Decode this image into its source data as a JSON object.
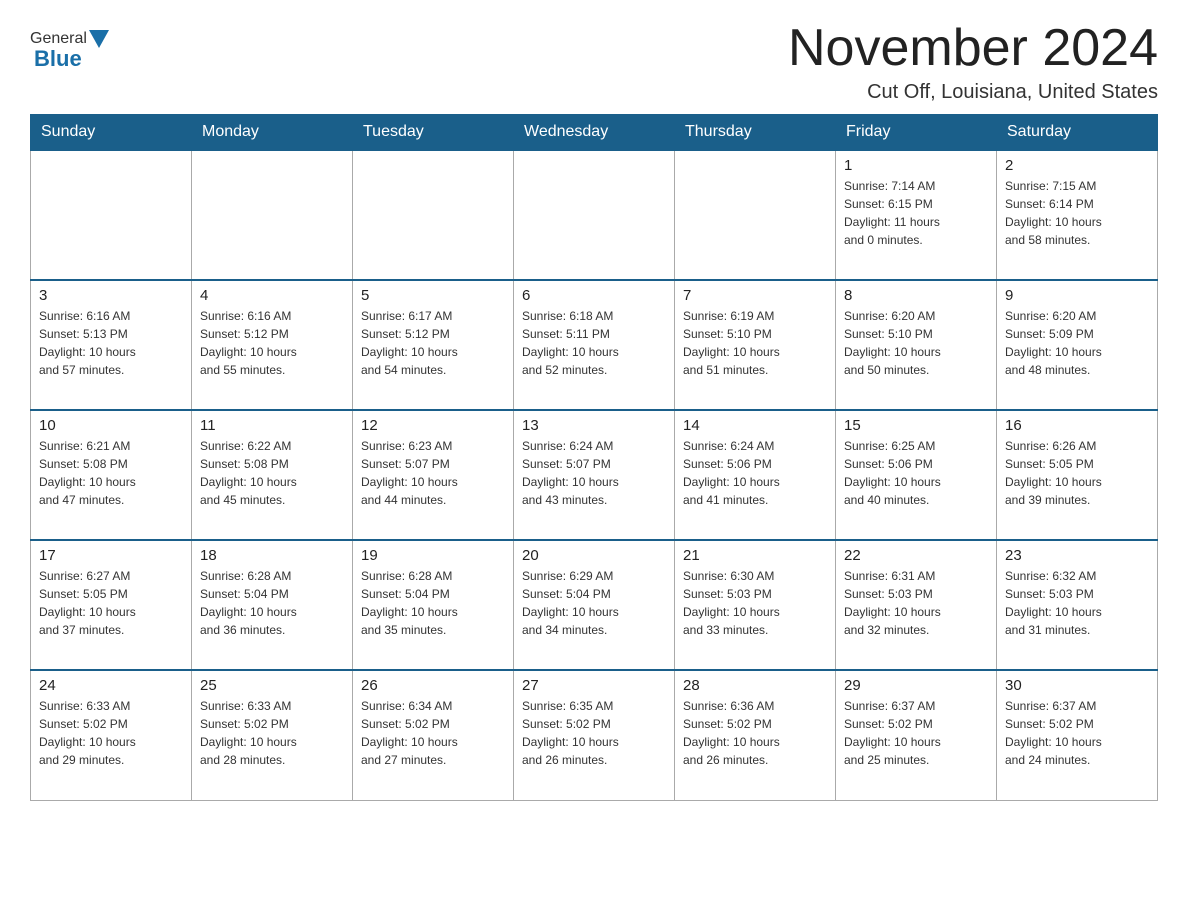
{
  "header": {
    "logo": {
      "general": "General",
      "blue": "Blue"
    },
    "title": "November 2024",
    "subtitle": "Cut Off, Louisiana, United States"
  },
  "calendar": {
    "days_of_week": [
      "Sunday",
      "Monday",
      "Tuesday",
      "Wednesday",
      "Thursday",
      "Friday",
      "Saturday"
    ],
    "weeks": [
      [
        {
          "day": "",
          "info": ""
        },
        {
          "day": "",
          "info": ""
        },
        {
          "day": "",
          "info": ""
        },
        {
          "day": "",
          "info": ""
        },
        {
          "day": "",
          "info": ""
        },
        {
          "day": "1",
          "info": "Sunrise: 7:14 AM\nSunset: 6:15 PM\nDaylight: 11 hours\nand 0 minutes."
        },
        {
          "day": "2",
          "info": "Sunrise: 7:15 AM\nSunset: 6:14 PM\nDaylight: 10 hours\nand 58 minutes."
        }
      ],
      [
        {
          "day": "3",
          "info": "Sunrise: 6:16 AM\nSunset: 5:13 PM\nDaylight: 10 hours\nand 57 minutes."
        },
        {
          "day": "4",
          "info": "Sunrise: 6:16 AM\nSunset: 5:12 PM\nDaylight: 10 hours\nand 55 minutes."
        },
        {
          "day": "5",
          "info": "Sunrise: 6:17 AM\nSunset: 5:12 PM\nDaylight: 10 hours\nand 54 minutes."
        },
        {
          "day": "6",
          "info": "Sunrise: 6:18 AM\nSunset: 5:11 PM\nDaylight: 10 hours\nand 52 minutes."
        },
        {
          "day": "7",
          "info": "Sunrise: 6:19 AM\nSunset: 5:10 PM\nDaylight: 10 hours\nand 51 minutes."
        },
        {
          "day": "8",
          "info": "Sunrise: 6:20 AM\nSunset: 5:10 PM\nDaylight: 10 hours\nand 50 minutes."
        },
        {
          "day": "9",
          "info": "Sunrise: 6:20 AM\nSunset: 5:09 PM\nDaylight: 10 hours\nand 48 minutes."
        }
      ],
      [
        {
          "day": "10",
          "info": "Sunrise: 6:21 AM\nSunset: 5:08 PM\nDaylight: 10 hours\nand 47 minutes."
        },
        {
          "day": "11",
          "info": "Sunrise: 6:22 AM\nSunset: 5:08 PM\nDaylight: 10 hours\nand 45 minutes."
        },
        {
          "day": "12",
          "info": "Sunrise: 6:23 AM\nSunset: 5:07 PM\nDaylight: 10 hours\nand 44 minutes."
        },
        {
          "day": "13",
          "info": "Sunrise: 6:24 AM\nSunset: 5:07 PM\nDaylight: 10 hours\nand 43 minutes."
        },
        {
          "day": "14",
          "info": "Sunrise: 6:24 AM\nSunset: 5:06 PM\nDaylight: 10 hours\nand 41 minutes."
        },
        {
          "day": "15",
          "info": "Sunrise: 6:25 AM\nSunset: 5:06 PM\nDaylight: 10 hours\nand 40 minutes."
        },
        {
          "day": "16",
          "info": "Sunrise: 6:26 AM\nSunset: 5:05 PM\nDaylight: 10 hours\nand 39 minutes."
        }
      ],
      [
        {
          "day": "17",
          "info": "Sunrise: 6:27 AM\nSunset: 5:05 PM\nDaylight: 10 hours\nand 37 minutes."
        },
        {
          "day": "18",
          "info": "Sunrise: 6:28 AM\nSunset: 5:04 PM\nDaylight: 10 hours\nand 36 minutes."
        },
        {
          "day": "19",
          "info": "Sunrise: 6:28 AM\nSunset: 5:04 PM\nDaylight: 10 hours\nand 35 minutes."
        },
        {
          "day": "20",
          "info": "Sunrise: 6:29 AM\nSunset: 5:04 PM\nDaylight: 10 hours\nand 34 minutes."
        },
        {
          "day": "21",
          "info": "Sunrise: 6:30 AM\nSunset: 5:03 PM\nDaylight: 10 hours\nand 33 minutes."
        },
        {
          "day": "22",
          "info": "Sunrise: 6:31 AM\nSunset: 5:03 PM\nDaylight: 10 hours\nand 32 minutes."
        },
        {
          "day": "23",
          "info": "Sunrise: 6:32 AM\nSunset: 5:03 PM\nDaylight: 10 hours\nand 31 minutes."
        }
      ],
      [
        {
          "day": "24",
          "info": "Sunrise: 6:33 AM\nSunset: 5:02 PM\nDaylight: 10 hours\nand 29 minutes."
        },
        {
          "day": "25",
          "info": "Sunrise: 6:33 AM\nSunset: 5:02 PM\nDaylight: 10 hours\nand 28 minutes."
        },
        {
          "day": "26",
          "info": "Sunrise: 6:34 AM\nSunset: 5:02 PM\nDaylight: 10 hours\nand 27 minutes."
        },
        {
          "day": "27",
          "info": "Sunrise: 6:35 AM\nSunset: 5:02 PM\nDaylight: 10 hours\nand 26 minutes."
        },
        {
          "day": "28",
          "info": "Sunrise: 6:36 AM\nSunset: 5:02 PM\nDaylight: 10 hours\nand 26 minutes."
        },
        {
          "day": "29",
          "info": "Sunrise: 6:37 AM\nSunset: 5:02 PM\nDaylight: 10 hours\nand 25 minutes."
        },
        {
          "day": "30",
          "info": "Sunrise: 6:37 AM\nSunset: 5:02 PM\nDaylight: 10 hours\nand 24 minutes."
        }
      ]
    ]
  }
}
